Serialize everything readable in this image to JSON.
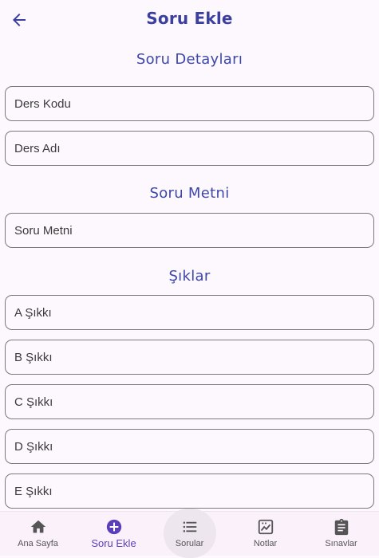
{
  "appbar": {
    "title": "Soru Ekle",
    "back_icon": "arrow-left-icon"
  },
  "sections": {
    "details": "Soru Detayları",
    "text": "Soru Metni",
    "options": "Şıklar"
  },
  "fields": {
    "course_code": {
      "placeholder": "Ders Kodu",
      "value": ""
    },
    "course_name": {
      "placeholder": "Ders Adı",
      "value": ""
    },
    "question_text": {
      "placeholder": "Soru Metni",
      "value": ""
    },
    "option_a": {
      "placeholder": "A Şıkkı",
      "value": ""
    },
    "option_b": {
      "placeholder": "B Şıkkı",
      "value": ""
    },
    "option_c": {
      "placeholder": "C Şıkkı",
      "value": ""
    },
    "option_d": {
      "placeholder": "D Şıkkı",
      "value": ""
    },
    "option_e": {
      "placeholder": "E Şıkkı",
      "value": ""
    }
  },
  "nav": {
    "items": [
      {
        "label": "Ana Sayfa",
        "icon": "home-icon"
      },
      {
        "label": "Soru Ekle",
        "icon": "add-circle-icon"
      },
      {
        "label": "Sorular",
        "icon": "list-icon"
      },
      {
        "label": "Notlar",
        "icon": "grade-icon"
      },
      {
        "label": "Sınavlar",
        "icon": "clipboard-icon"
      }
    ],
    "active_index": 1
  },
  "colors": {
    "background": "#fdf7fe",
    "title": "#3a3fa0",
    "section": "#3d47a8",
    "nav_active": "#5b3fb8",
    "nav_background": "#fbf1fb"
  }
}
